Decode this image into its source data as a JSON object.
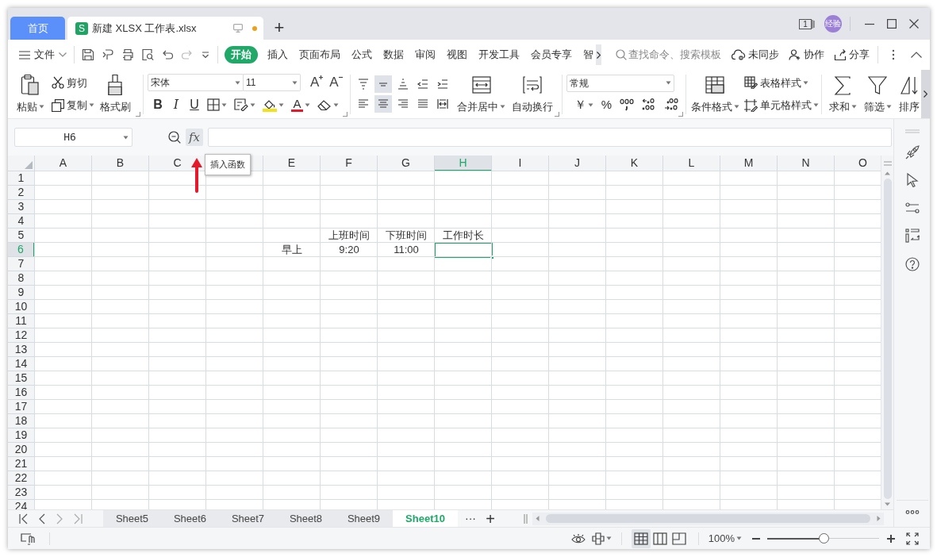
{
  "title_bar": {
    "home_tab": "首页",
    "document_tab": {
      "app_letter": "S",
      "title": "新建 XLSX 工作表.xlsx",
      "unsaved": true
    },
    "new_tab": "+",
    "window_count": "1",
    "avatar": "经验"
  },
  "menu": {
    "file": "文件",
    "tabs": [
      {
        "label": "开始",
        "selected": true
      },
      {
        "label": "插入",
        "selected": false
      },
      {
        "label": "页面布局",
        "selected": false
      },
      {
        "label": "公式",
        "selected": false
      },
      {
        "label": "数据",
        "selected": false
      },
      {
        "label": "审阅",
        "selected": false
      },
      {
        "label": "视图",
        "selected": false
      },
      {
        "label": "开发工具",
        "selected": false
      },
      {
        "label": "会员专享",
        "selected": false
      },
      {
        "label": "智",
        "selected": false
      }
    ],
    "search": {
      "placeholder": "查找命令、搜索模板"
    },
    "sync": "未同步",
    "collaborate": "协作",
    "share": "分享"
  },
  "ribbon": {
    "paste": "粘贴",
    "cut": "剪切",
    "copy": "复制",
    "format_painter": "格式刷",
    "font_family": "宋体",
    "font_size": "11",
    "grow_font": "A",
    "shrink_font": "A",
    "bold": "B",
    "italic": "I",
    "underline": "U",
    "font_color": "A",
    "alignment_row_1": [
      {
        "selected": false
      },
      {
        "selected": true
      },
      {
        "selected": false
      },
      {
        "selected": false
      },
      {
        "selected": false
      }
    ],
    "alignment_row_2": [
      {
        "selected": false
      },
      {
        "selected": true
      },
      {
        "selected": false
      },
      {
        "selected": false
      },
      {
        "selected": false
      }
    ],
    "merge_center": "合并居中",
    "wrap_text": "自动换行",
    "number_format": "常规",
    "currency": "￥",
    "percent": "%",
    "conditional_format": "条件格式",
    "table_style": "表格样式",
    "cell_style": "单元格样式",
    "sum": "求和",
    "filter": "筛选",
    "sort": "排序"
  },
  "formula_bar": {
    "name_box": "H6",
    "function_button": "fx",
    "tooltip": "插入函数"
  },
  "grid": {
    "columns": [
      {
        "label": "A",
        "selected": false
      },
      {
        "label": "B",
        "selected": false
      },
      {
        "label": "C",
        "selected": false
      },
      {
        "selected": false
      },
      {
        "label": "E",
        "selected": false
      },
      {
        "label": "F",
        "selected": false
      },
      {
        "label": "G",
        "selected": false
      },
      {
        "label": "H",
        "selected": true
      },
      {
        "label": "I",
        "selected": false
      },
      {
        "label": "J",
        "selected": false
      },
      {
        "label": "K",
        "selected": false
      },
      {
        "label": "L",
        "selected": false
      },
      {
        "label": "M",
        "selected": false
      },
      {
        "label": "N",
        "selected": false
      },
      {
        "label": "O",
        "selected": false
      }
    ],
    "rows": [
      {
        "label": "1",
        "selected": false
      },
      {
        "label": "2",
        "selected": false
      },
      {
        "label": "3",
        "selected": false
      },
      {
        "label": "4",
        "selected": false
      },
      {
        "label": "5",
        "selected": false,
        "cells": [
          null,
          null,
          null,
          null,
          null,
          "上班时间",
          "下班时间",
          "工作时长",
          null,
          null,
          null,
          null,
          null,
          null,
          null
        ]
      },
      {
        "label": "6",
        "selected": true,
        "cells": [
          null,
          null,
          null,
          null,
          "早上",
          "9:20",
          "11:00",
          null,
          null,
          null,
          null,
          null,
          null,
          null,
          null
        ]
      },
      {
        "label": "7",
        "selected": false
      },
      {
        "label": "8",
        "selected": false
      },
      {
        "label": "9",
        "selected": false
      },
      {
        "label": "10",
        "selected": false
      },
      {
        "label": "11",
        "selected": false
      },
      {
        "label": "12",
        "selected": false
      },
      {
        "label": "13",
        "selected": false
      },
      {
        "label": "14",
        "selected": false
      },
      {
        "label": "15",
        "selected": false
      },
      {
        "label": "16",
        "selected": false
      },
      {
        "label": "17",
        "selected": false
      },
      {
        "label": "18",
        "selected": false
      },
      {
        "label": "19",
        "selected": false
      },
      {
        "label": "20",
        "selected": false
      },
      {
        "label": "21",
        "selected": false
      },
      {
        "label": "22",
        "selected": false
      },
      {
        "label": "23",
        "selected": false
      },
      {
        "label": "24",
        "selected": false
      }
    ]
  },
  "sheet_tabs": {
    "tabs": [
      {
        "label": "Sheet5",
        "selected": false
      },
      {
        "label": "Sheet6",
        "selected": false
      },
      {
        "label": "Sheet7",
        "selected": false
      },
      {
        "label": "Sheet8",
        "selected": false
      },
      {
        "label": "Sheet9",
        "selected": false
      },
      {
        "label": "Sheet10",
        "selected": true
      }
    ],
    "more": "···",
    "add": "+"
  },
  "status_bar": {
    "view_modes": [
      {
        "selected": true
      },
      {
        "selected": false
      },
      {
        "selected": false
      }
    ],
    "zoom": "100%",
    "zoom_slider": {
      "level": 0.5
    }
  }
}
